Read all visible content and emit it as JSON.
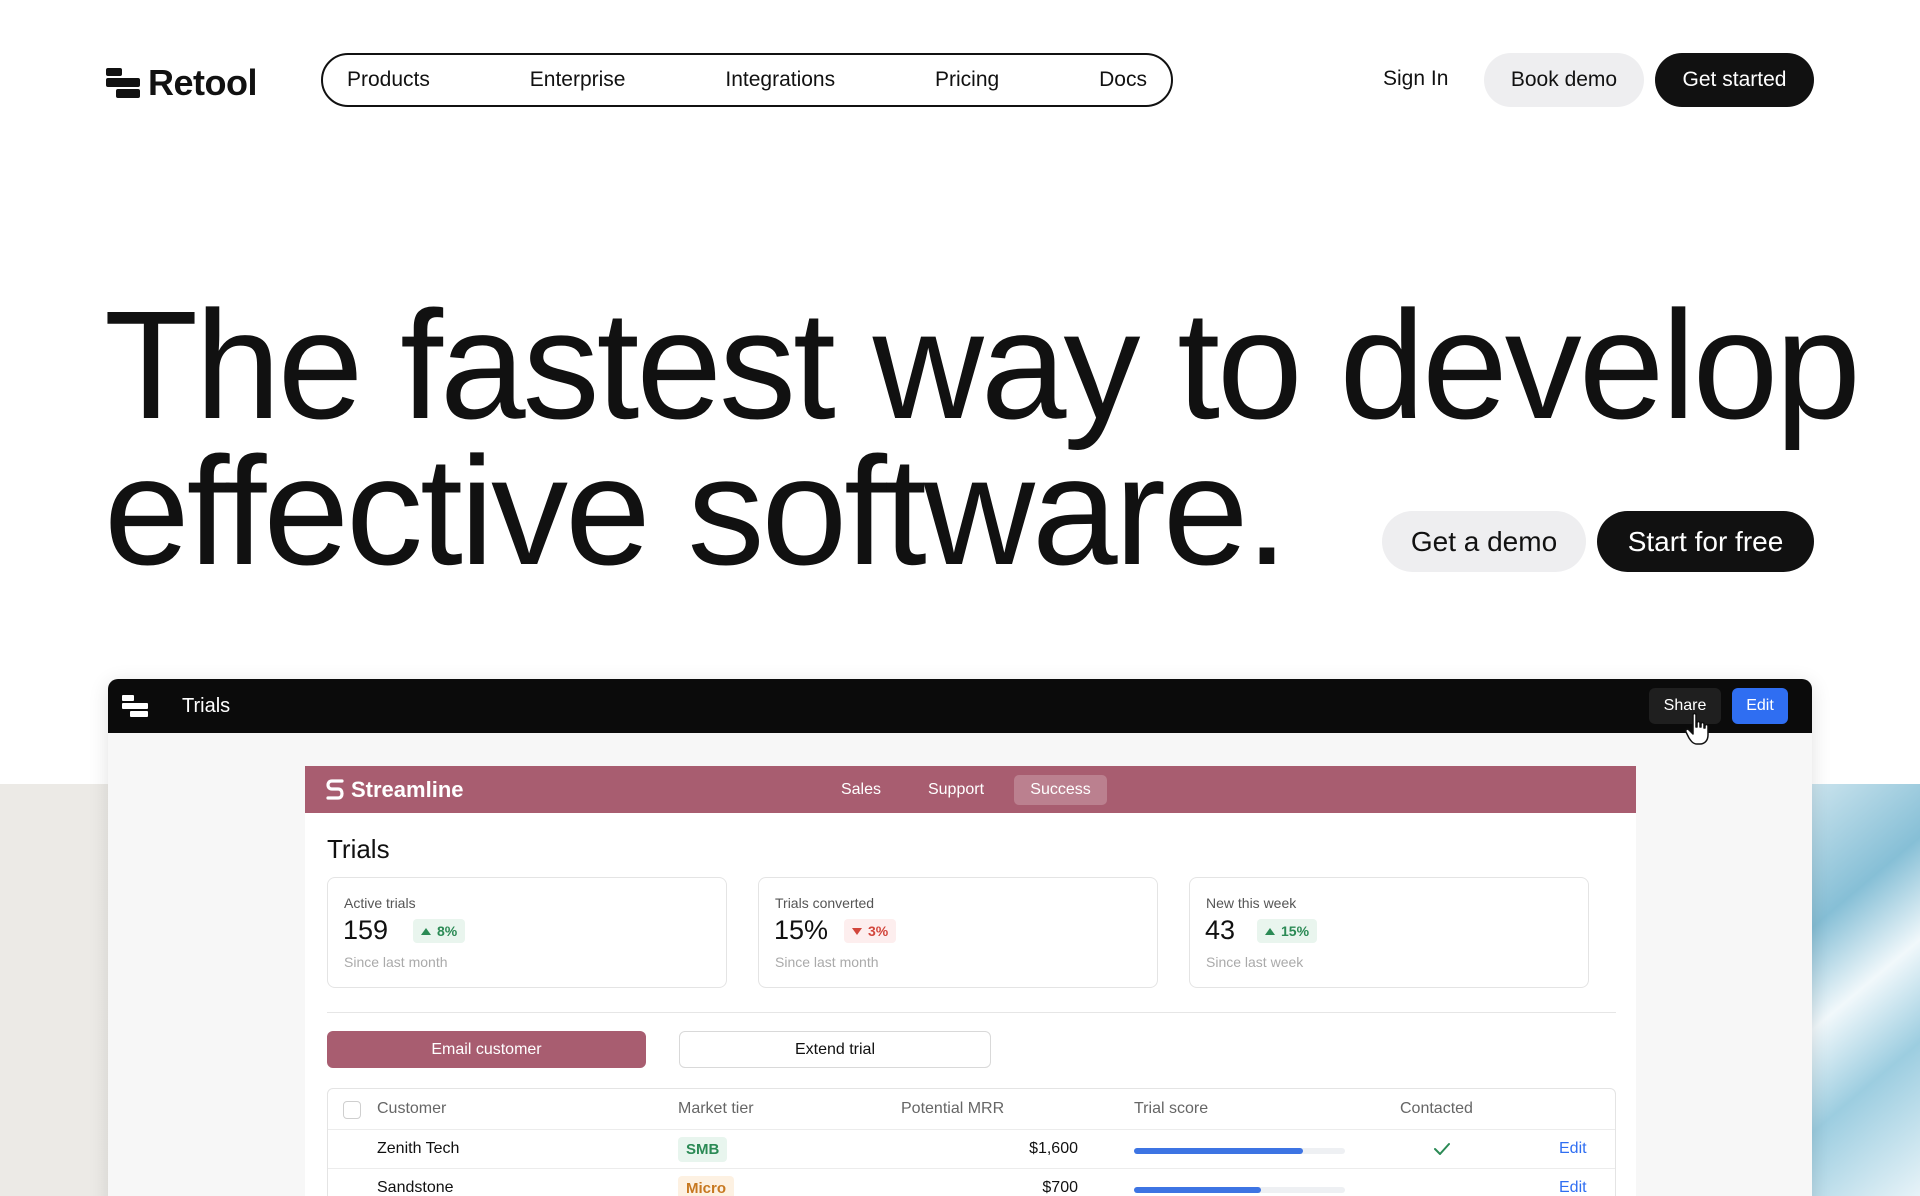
{
  "header": {
    "logo_text": "Retool",
    "nav": [
      "Products",
      "Enterprise",
      "Integrations",
      "Pricing",
      "Docs"
    ],
    "sign_in": "Sign In",
    "book_demo": "Book demo",
    "get_started": "Get started"
  },
  "hero": {
    "line1": "The fastest way to develop",
    "line2": "effective software.",
    "cta_demo": "Get a demo",
    "cta_free": "Start for free"
  },
  "app": {
    "title": "Trials",
    "share": "Share",
    "edit": "Edit",
    "inner": {
      "brand": "Streamline",
      "tabs": [
        "Sales",
        "Support",
        "Success"
      ],
      "active_tab": "Success",
      "heading": "Trials",
      "stats": [
        {
          "label": "Active trials",
          "value": "159",
          "change": "8%",
          "direction": "up",
          "sub": "Since last month"
        },
        {
          "label": "Trials converted",
          "value": "15%",
          "change": "3%",
          "direction": "down",
          "sub": "Since last month"
        },
        {
          "label": "New this week",
          "value": "43",
          "change": "15%",
          "direction": "up",
          "sub": "Since last week"
        }
      ],
      "buttons": {
        "email": "Email customer",
        "extend": "Extend trial"
      },
      "table": {
        "columns": [
          "Customer",
          "Market tier",
          "Potential MRR",
          "Trial score",
          "Contacted"
        ],
        "rows": [
          {
            "customer": "Zenith Tech",
            "tier": "SMB",
            "mrr": "$1,600",
            "score": 0.8,
            "contacted": true,
            "action": "Edit"
          },
          {
            "customer": "Sandstone",
            "tier": "Micro",
            "mrr": "$700",
            "score": 0.6,
            "contacted": false,
            "action": "Edit"
          }
        ]
      }
    }
  },
  "colors": {
    "brand_dark": "#111111",
    "streamline_accent": "#a85d70",
    "edit_blue": "#2f6ef2",
    "positive": "#2b8a55",
    "negative": "#d2463c"
  },
  "icons": [
    "retool-logo-icon",
    "app-menu-icon",
    "pointer-hand-icon",
    "streamline-logo-icon",
    "checkmark-icon",
    "triangle-up-icon",
    "triangle-down-icon"
  ]
}
